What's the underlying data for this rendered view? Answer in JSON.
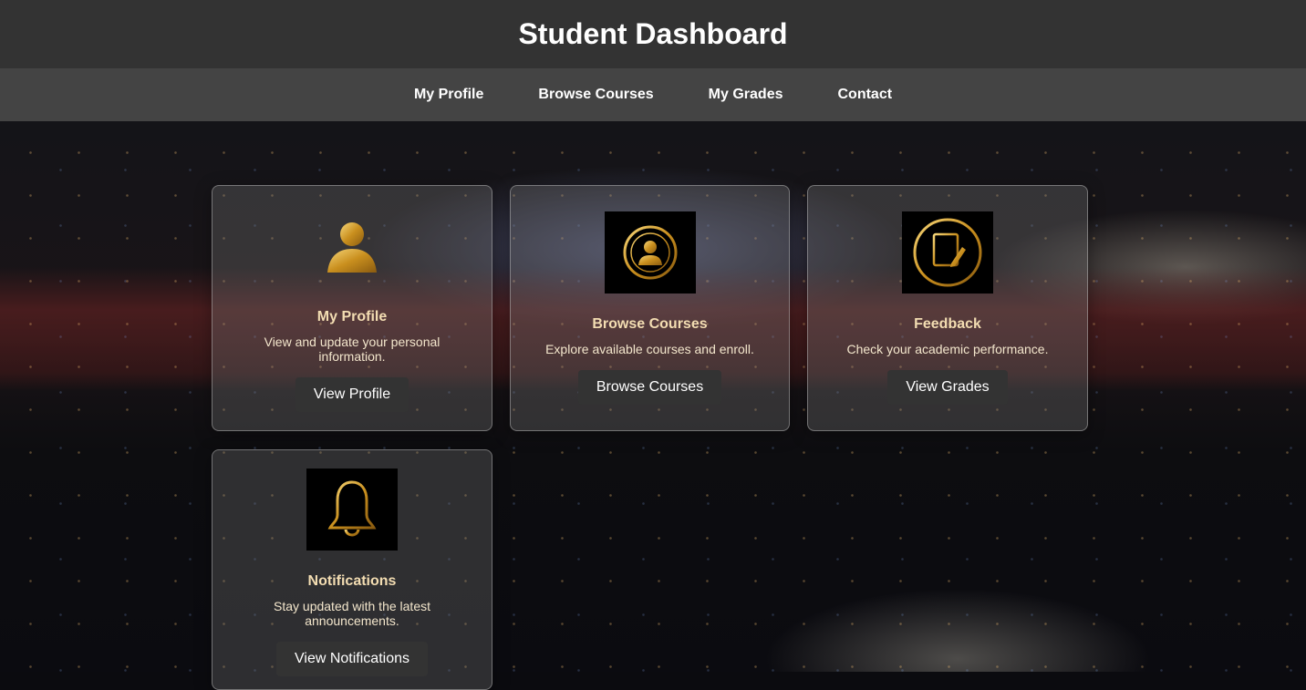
{
  "header": {
    "title": "Student Dashboard"
  },
  "nav": {
    "items": [
      {
        "label": "My Profile"
      },
      {
        "label": "Browse Courses"
      },
      {
        "label": "My Grades"
      },
      {
        "label": "Contact"
      }
    ]
  },
  "cards": [
    {
      "icon": "user-icon",
      "title": "My Profile",
      "description": "View and update your personal information.",
      "button": "View Profile"
    },
    {
      "icon": "user-circle-icon",
      "title": "Browse Courses",
      "description": "Explore available courses and enroll.",
      "button": "Browse Courses"
    },
    {
      "icon": "document-edit-icon",
      "title": "Feedback",
      "description": "Check your academic performance.",
      "button": "View Grades"
    },
    {
      "icon": "bell-icon",
      "title": "Notifications",
      "description": "Stay updated with the latest announcements.",
      "button": "View Notifications"
    }
  ],
  "colors": {
    "header_bg": "#333333",
    "nav_bg": "#444444",
    "accent_gold": "#d4a73a",
    "card_title": "#f3ddb2"
  }
}
